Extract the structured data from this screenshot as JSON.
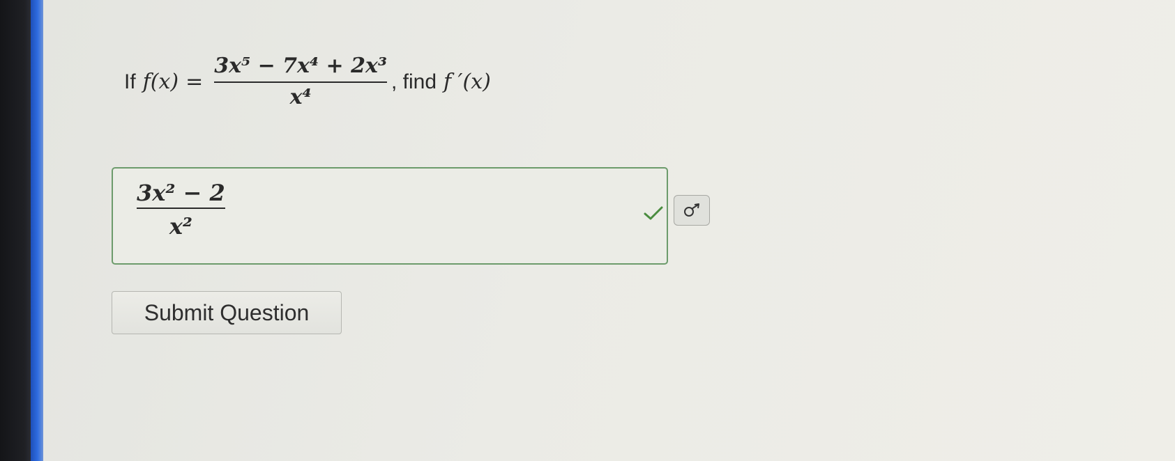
{
  "question": {
    "prefix": "If",
    "function_lhs": "f(x)",
    "equals": "=",
    "numerator": "3x⁵ − 7x⁴ + 2x³",
    "denominator": "x⁴",
    "suffix": ", find",
    "target": "f ′(x)"
  },
  "answer": {
    "numerator": "3x² − 2",
    "denominator": "x²",
    "status_icon": "check-icon",
    "status_color": "#4a8c3f"
  },
  "preview": {
    "icon": "preview-icon"
  },
  "submit": {
    "label": "Submit Question"
  },
  "colors": {
    "answer_border": "#6c9b6b",
    "edge_blue": "#2f6ce0"
  }
}
